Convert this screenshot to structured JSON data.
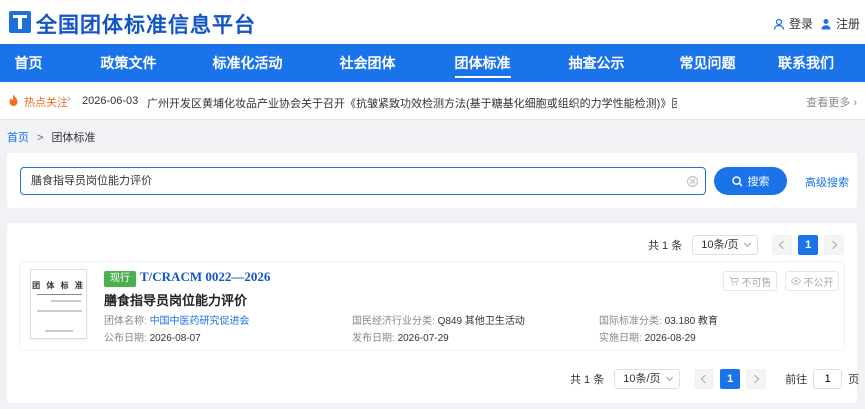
{
  "header": {
    "site_title": "全国团体标准信息平台",
    "login_label": "登录",
    "register_label": "注册"
  },
  "nav": {
    "items": [
      "首页",
      "政策文件",
      "标准化活动",
      "社会团体",
      "团体标准",
      "抽查公示",
      "常见问题",
      "联系我们"
    ],
    "active_index": 4
  },
  "hot": {
    "label": "热点关注",
    "sep": "›",
    "date": "2026-06-03",
    "text": "广州开发区黄埔化妆品产业协会关于召开《抗皱紧致功效检测方法(基于糖基化细胞或组织的力学性能检测)》团体标准研讨会议的通知",
    "more": "查看更多 ›"
  },
  "breadcrumb": {
    "home": "首页",
    "sep": ">",
    "current": "团体标准"
  },
  "search": {
    "value": "膳食指导员岗位能力评价",
    "button_label": "搜索",
    "advanced_label": "高级搜索"
  },
  "pagination": {
    "total_label": "共 1 条",
    "page_size": "10条/页",
    "current_page": "1",
    "goto_label": "前往",
    "goto_value": "1",
    "page_suffix": "页"
  },
  "result": {
    "status": "现行",
    "code": "T/CRACM 0022—2026",
    "title": "膳食指导员岗位能力评价",
    "thumb_title": "团 体 标 准",
    "org_label": "团体名称: ",
    "org_value": "中国中医药研究促进会",
    "industry_label": "国民经济行业分类: ",
    "industry_value": "Q849 其他卫生活动",
    "ics_label": "国际标准分类: ",
    "ics_value": "03.180 教育",
    "publish_label": "公布日期: ",
    "publish_value": "2026-08-07",
    "release_label": "发布日期: ",
    "release_value": "2026-07-29",
    "implement_label": "实施日期: ",
    "implement_value": "2026-08-29",
    "btn_not_for_sale": "不可售",
    "btn_not_public": "不公开"
  },
  "colors": {
    "primary": "#1a73e8",
    "title_blue": "#1256c4",
    "status_green": "#4cb050",
    "hot_orange": "#f56c22"
  }
}
